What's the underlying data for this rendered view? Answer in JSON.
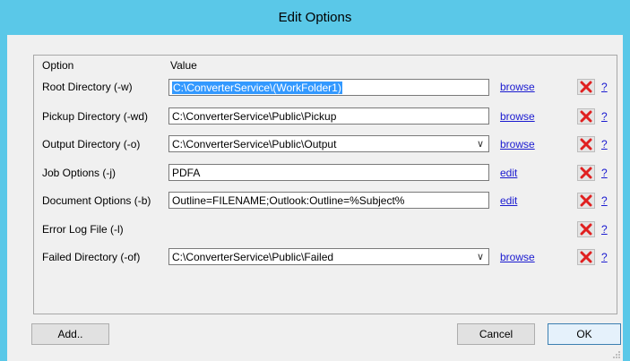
{
  "window": {
    "title": "Edit Options"
  },
  "headers": {
    "option": "Option",
    "value": "Value"
  },
  "rows": [
    {
      "label": "Root Directory (-w)",
      "value": "C:\\ConverterService\\(WorkFolder1)",
      "action": "browse",
      "help": "?"
    },
    {
      "label": "Pickup Directory (-wd)",
      "value": "C:\\ConverterService\\Public\\Pickup",
      "action": "browse",
      "help": "?"
    },
    {
      "label": "Output Directory (-o)",
      "value": "C:\\ConverterService\\Public\\Output",
      "action": "browse",
      "help": "?"
    },
    {
      "label": "Job Options (-j)",
      "value": "PDFA",
      "action": "edit",
      "help": "?"
    },
    {
      "label": "Document Options (-b)",
      "value": "Outline=FILENAME;Outlook:Outline=%Subject%",
      "action": "edit",
      "help": "?"
    },
    {
      "label": "Error Log File (-l)",
      "value": "",
      "action": "",
      "help": "?"
    },
    {
      "label": "Failed Directory (-of)",
      "value": "C:\\ConverterService\\Public\\Failed",
      "action": "browse",
      "help": "?"
    }
  ],
  "buttons": {
    "add": "Add..",
    "cancel": "Cancel",
    "ok": "OK"
  },
  "colors": {
    "titlebar": "#5ac8e8",
    "link": "#1a1ad0",
    "delete_x": "#e02020",
    "selection": "#3399ff"
  },
  "icons": {
    "delete": "red-x-icon",
    "dropdown": "chevron-down-icon"
  }
}
